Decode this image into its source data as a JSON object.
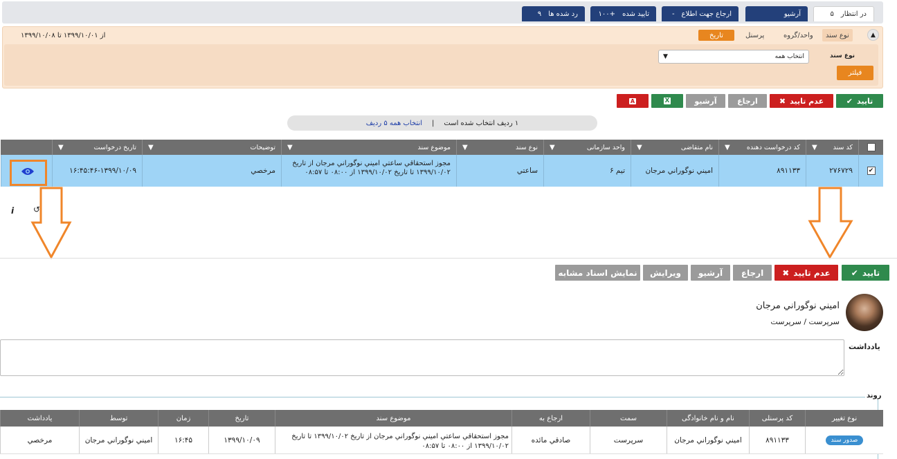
{
  "top_tabs": [
    {
      "label": "در انتظار",
      "count": "۵",
      "active": true
    },
    {
      "label": "آرشیو",
      "count": "",
      "active": false
    },
    {
      "label": "ارجاع جهت اطلاع",
      "count": "-",
      "active": false
    },
    {
      "label": "تایید شده",
      "count": "+۱۰۰",
      "active": false
    },
    {
      "label": "رد شده ها",
      "count": "۹",
      "active": false
    }
  ],
  "filter": {
    "collapse_icon": "chevron-up-icon",
    "tabs": [
      "نوع سند",
      "واحد/گروه",
      "پرسنل",
      "تاریخ"
    ],
    "active_tab": "نوع سند",
    "date_range": "از ۱۳۹۹/۱۰/۰۱   تا ۱۳۹۹/۱۰/۰۸",
    "doc_type_label": "نوع سند",
    "doc_type_value": "انتخاب همه",
    "filter_button": "فیلتر"
  },
  "actions": {
    "approve": "تایید",
    "reject": "عدم تایید",
    "refer": "ارجاع",
    "archive": "آرشیو"
  },
  "selection": {
    "text": "۱ ردیف انتخاب شده است",
    "link": "انتخاب همه ۵ ردیف"
  },
  "grid": {
    "headers": [
      "کد سند",
      "کد درخواست دهنده",
      "نام متقاضی",
      "واحد سازمانی",
      "نوع سند",
      "موضوع سند",
      "توضیحات",
      "تاریخ درخواست"
    ],
    "row": {
      "doc_code": "۲۷۶۷۲۹",
      "requester_code": "۸۹۱۱۳۳",
      "applicant": "اميني نوگوراني مرجان",
      "unit": "تیم ۶",
      "doc_type": "ساعتي",
      "subject": "مجوز استحقاقي ساعتي اميني نوگوراني مرجان از تاريخ ۱۳۹۹/۱۰/۰۲ تا تاريخ ۱۳۹۹/۱۰/۰۲ از ۰۸:۰۰ تا ۰۸:۵۷",
      "description": "مرخصي",
      "request_date": "۱۶:۴۵:۴۶-۱۳۹۹/۱۰/۰۹"
    }
  },
  "detail_actions": {
    "approve": "تایید",
    "reject": "عدم تایید",
    "refer": "ارجاع",
    "archive": "آرشیو",
    "edit": "ویرایش",
    "similar": "نمایش اسناد مشابه"
  },
  "user": {
    "name": "اميني نوگوراني مرجان",
    "role": "سرپرست / سرپرست"
  },
  "note_label": "یادداشت",
  "process": {
    "legend": "روند",
    "headers": [
      "نوع تغییر",
      "کد پرسنلی",
      "نام و نام خانوادگی",
      "سمت",
      "ارجاع به",
      "موضوع سند",
      "تاریخ",
      "زمان",
      "توسط",
      "یادداشت"
    ],
    "row": {
      "change_type": "صدور سند",
      "personnel_code": "۸۹۱۱۳۳",
      "full_name": "اميني نوگوراني مرجان",
      "position": "سرپرست",
      "referred_to": "صادقي مائده",
      "subject": "مجوز استحقاقي ساعتي اميني نوگوراني مرجان از تاريخ ۱۳۹۹/۱۰/۰۲ تا تاريخ ۱۳۹۹/۱۰/۰۲ از ۰۸:۰۰ تا ۰۸:۵۷",
      "date": "۱۳۹۹/۱۰/۰۹",
      "time": "۱۶:۴۵",
      "by": "اميني نوگوراني مرجان",
      "note": "مرخصي"
    }
  },
  "colors": {
    "primary": "#23407a",
    "approve": "#2f8a4d",
    "reject": "#cc1f1f",
    "accent": "#e8861f",
    "highlight": "#f0862a",
    "row_selected": "#9fd4f6"
  }
}
